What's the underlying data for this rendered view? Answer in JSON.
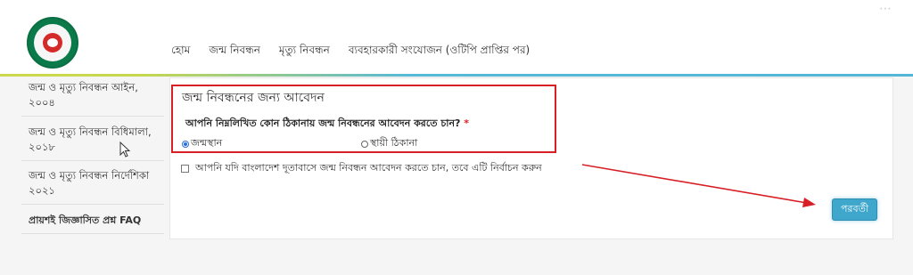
{
  "header": {
    "nav": [
      "হোম",
      "জন্ম নিবন্ধন",
      "মৃত্যু নিবন্ধন",
      "ব্যবহারকারী সংযোজন (ওটিপি প্রাপ্তির পর)"
    ]
  },
  "sidebar": {
    "items": [
      "জন্ম ও মৃত্যু নিবন্ধন আইন, ২০০৪",
      "জন্ম ও মৃত্যু নিবন্ধন বিধিমালা, ২০১৮",
      "জন্ম ও মৃত্যু নিবন্ধন নির্দেশিকা ২০২১",
      "প্রায়শই জিজ্ঞাসিত প্রশ্ন FAQ"
    ]
  },
  "form": {
    "title": "জন্ম নিবন্ধনের জন্য আবেদন",
    "question": "আপনি নিম্নলিখিত কোন ঠিকানায় জন্ম নিবন্ধনের আবেদন করতে চান?",
    "required_mark": "*",
    "options": [
      {
        "label": "জন্মস্থান",
        "selected": true
      },
      {
        "label": "স্থায়ী ঠিকানা",
        "selected": false
      }
    ],
    "embassy_checkbox_label": "আপনি যদি বাংলাদেশ দূতাবাসে জন্ম নিবন্ধন আবেদন করতে চান, তবে এটি নির্বাচন করুন",
    "embassy_checked": false,
    "next_button": "পরবর্তী"
  },
  "colors": {
    "highlight": "#d81f26",
    "button": "#3fa7cc",
    "radio_selected": "#2a6fd6",
    "logo_green": "#0b7a4b",
    "logo_red": "#d52a2a"
  }
}
